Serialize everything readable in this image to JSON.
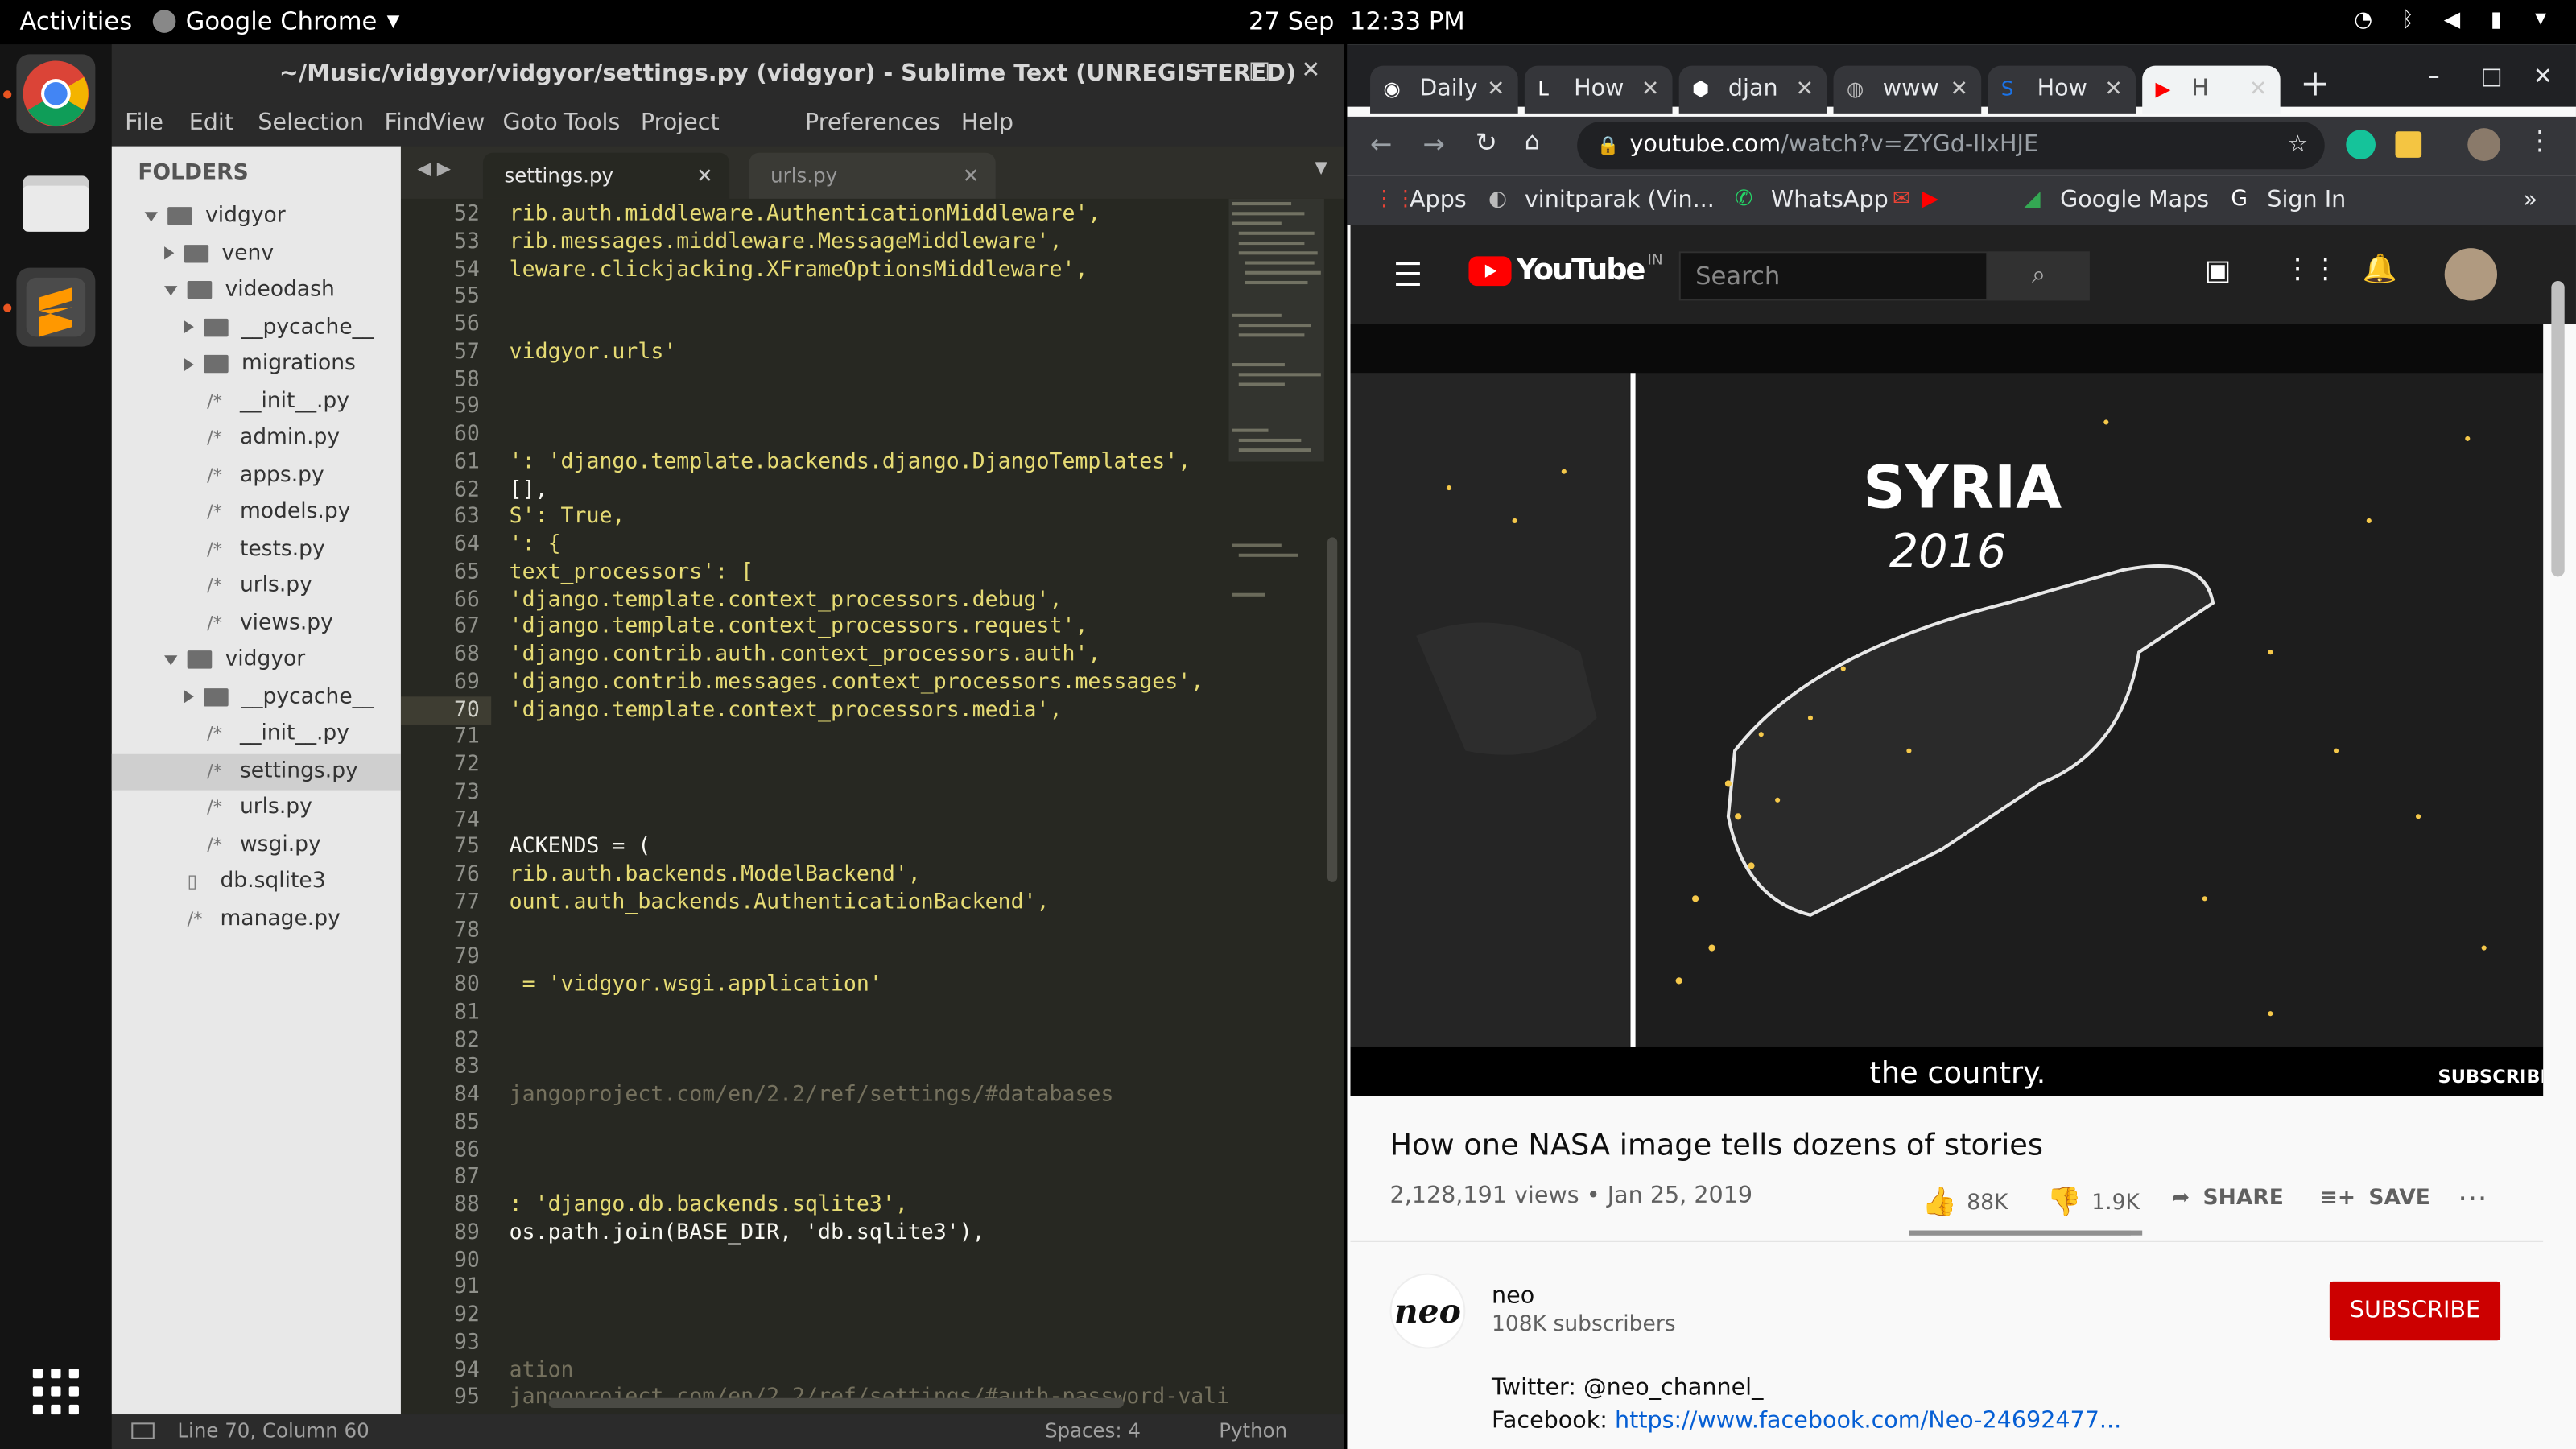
{
  "topbar": {
    "activities": "Activities",
    "app": "Google Chrome",
    "date": "27 Sep",
    "time": "12:33 PM"
  },
  "sublime": {
    "title": "~/Music/vidgyor/vidgyor/settings.py (vidgyor) - Sublime Text (UNREGISTERED)",
    "menu": [
      "File",
      "Edit",
      "Selection",
      "Find",
      "View",
      "Goto",
      "Tools",
      "Project",
      "Preferences",
      "Help"
    ],
    "folders_header": "FOLDERS",
    "tree": [
      {
        "label": "vidgyor",
        "type": "folder",
        "open": true,
        "level": 0
      },
      {
        "label": "venv",
        "type": "folder",
        "open": false,
        "level": 1
      },
      {
        "label": "videodash",
        "type": "folder",
        "open": true,
        "level": 1
      },
      {
        "label": "__pycache__",
        "type": "folder",
        "open": false,
        "level": 2
      },
      {
        "label": "migrations",
        "type": "folder",
        "open": false,
        "level": 2
      },
      {
        "label": "__init__.py",
        "type": "file",
        "level": 2
      },
      {
        "label": "admin.py",
        "type": "file",
        "level": 2
      },
      {
        "label": "apps.py",
        "type": "file",
        "level": 2
      },
      {
        "label": "models.py",
        "type": "file",
        "level": 2
      },
      {
        "label": "tests.py",
        "type": "file",
        "level": 2
      },
      {
        "label": "urls.py",
        "type": "file",
        "level": 2
      },
      {
        "label": "views.py",
        "type": "file",
        "level": 2
      },
      {
        "label": "vidgyor",
        "type": "folder",
        "open": true,
        "level": 1
      },
      {
        "label": "__pycache__",
        "type": "folder",
        "open": false,
        "level": 2
      },
      {
        "label": "__init__.py",
        "type": "file",
        "level": 2
      },
      {
        "label": "settings.py",
        "type": "file",
        "level": 2,
        "selected": true
      },
      {
        "label": "urls.py",
        "type": "file",
        "level": 2
      },
      {
        "label": "wsgi.py",
        "type": "file",
        "level": 2
      },
      {
        "label": "db.sqlite3",
        "type": "doc",
        "level": 1
      },
      {
        "label": "manage.py",
        "type": "file",
        "level": 1
      }
    ],
    "tabs": [
      {
        "label": "settings.py",
        "active": true
      },
      {
        "label": "urls.py",
        "active": false
      }
    ],
    "lines": [
      {
        "n": "52",
        "code": "rib.auth.middleware.AuthenticationMiddleware',",
        "cls": "s"
      },
      {
        "n": "53",
        "code": "rib.messages.middleware.MessageMiddleware',",
        "cls": "s"
      },
      {
        "n": "54",
        "code": "leware.clickjacking.XFrameOptionsMiddleware',",
        "cls": "s"
      },
      {
        "n": "55",
        "code": "",
        "cls": ""
      },
      {
        "n": "56",
        "code": "",
        "cls": ""
      },
      {
        "n": "57",
        "code": "vidgyor.urls'",
        "cls": "s"
      },
      {
        "n": "58",
        "code": "",
        "cls": ""
      },
      {
        "n": "59",
        "code": "",
        "cls": ""
      },
      {
        "n": "60",
        "code": "",
        "cls": ""
      },
      {
        "n": "61",
        "code": "': 'django.template.backends.django.DjangoTemplates',",
        "cls": "s"
      },
      {
        "n": "62",
        "code": "[],",
        "cls": ""
      },
      {
        "n": "63",
        "code": "S': True,",
        "cls": "s"
      },
      {
        "n": "64",
        "code": "': {",
        "cls": "s"
      },
      {
        "n": "65",
        "code": "text_processors': [",
        "cls": "s"
      },
      {
        "n": "66",
        "code": "'django.template.context_processors.debug',",
        "cls": "s"
      },
      {
        "n": "67",
        "code": "'django.template.context_processors.request',",
        "cls": "s"
      },
      {
        "n": "68",
        "code": "'django.contrib.auth.context_processors.auth',",
        "cls": "s"
      },
      {
        "n": "69",
        "code": "'django.contrib.messages.context_processors.messages',",
        "cls": "s"
      },
      {
        "n": "70",
        "code": "'django.template.context_processors.media',",
        "cls": "s"
      },
      {
        "n": "71",
        "code": "",
        "cls": ""
      },
      {
        "n": "72",
        "code": "",
        "cls": ""
      },
      {
        "n": "73",
        "code": "",
        "cls": ""
      },
      {
        "n": "74",
        "code": "",
        "cls": ""
      },
      {
        "n": "75",
        "code": "ACKENDS = (",
        "cls": ""
      },
      {
        "n": "76",
        "code": "rib.auth.backends.ModelBackend',",
        "cls": "s"
      },
      {
        "n": "77",
        "code": "ount.auth_backends.AuthenticationBackend',",
        "cls": "s"
      },
      {
        "n": "78",
        "code": "",
        "cls": ""
      },
      {
        "n": "79",
        "code": "",
        "cls": ""
      },
      {
        "n": "80",
        "code": " = 'vidgyor.wsgi.application'",
        "cls": "s"
      },
      {
        "n": "81",
        "code": "",
        "cls": ""
      },
      {
        "n": "82",
        "code": "",
        "cls": ""
      },
      {
        "n": "83",
        "code": "",
        "cls": ""
      },
      {
        "n": "84",
        "code": "jangoproject.com/en/2.2/ref/settings/#databases",
        "cls": "c"
      },
      {
        "n": "85",
        "code": "",
        "cls": ""
      },
      {
        "n": "86",
        "code": "",
        "cls": ""
      },
      {
        "n": "87",
        "code": "",
        "cls": ""
      },
      {
        "n": "88",
        "code": ": 'django.db.backends.sqlite3',",
        "cls": "s"
      },
      {
        "n": "89",
        "code": "os.path.join(BASE_DIR, 'db.sqlite3'),",
        "cls": ""
      },
      {
        "n": "90",
        "code": "",
        "cls": ""
      },
      {
        "n": "91",
        "code": "",
        "cls": ""
      },
      {
        "n": "92",
        "code": "",
        "cls": ""
      },
      {
        "n": "93",
        "code": "",
        "cls": ""
      },
      {
        "n": "94",
        "code": "ation",
        "cls": "c"
      },
      {
        "n": "95",
        "code": "jangoproject.com/en/2.2/ref/settings/#auth-password-vali",
        "cls": "c"
      }
    ],
    "status": {
      "position": "Line 70, Column 60",
      "spaces": "Spaces: 4",
      "syntax": "Python"
    }
  },
  "chrome": {
    "tabs": [
      "Daily",
      "How",
      "djan",
      "www",
      "How",
      "H"
    ],
    "url_host": "youtube.com",
    "url_path": "/watch?v=ZYGd-llxHJE",
    "bookmarks": [
      "Apps",
      "vinitparak (Vin...",
      "WhatsApp",
      "",
      "",
      "Google Maps",
      "Sign In"
    ],
    "more": "»"
  },
  "youtube": {
    "logo": "YouTube",
    "region": "IN",
    "search_placeholder": "Search",
    "video_title_overlay": "SYRIA",
    "video_year_overlay": "2016",
    "caption": "the country.",
    "subscribe_watermark": "SUBSCRIBE",
    "title": "How one NASA image tells dozens of stories",
    "meta": "2,128,191 views • Jan 25, 2019",
    "likes": "88K",
    "dislikes": "1.9K",
    "share": "SHARE",
    "save": "SAVE",
    "channel_logo": "neo",
    "channel": "neo",
    "subscribers": "108K subscribers",
    "subscribe": "SUBSCRIBE",
    "desc_line1": "Twitter: @neo_channel_",
    "desc_line2_label": "Facebook: ",
    "desc_line2_link": "https://www.facebook.com/Neo-24692477..."
  }
}
